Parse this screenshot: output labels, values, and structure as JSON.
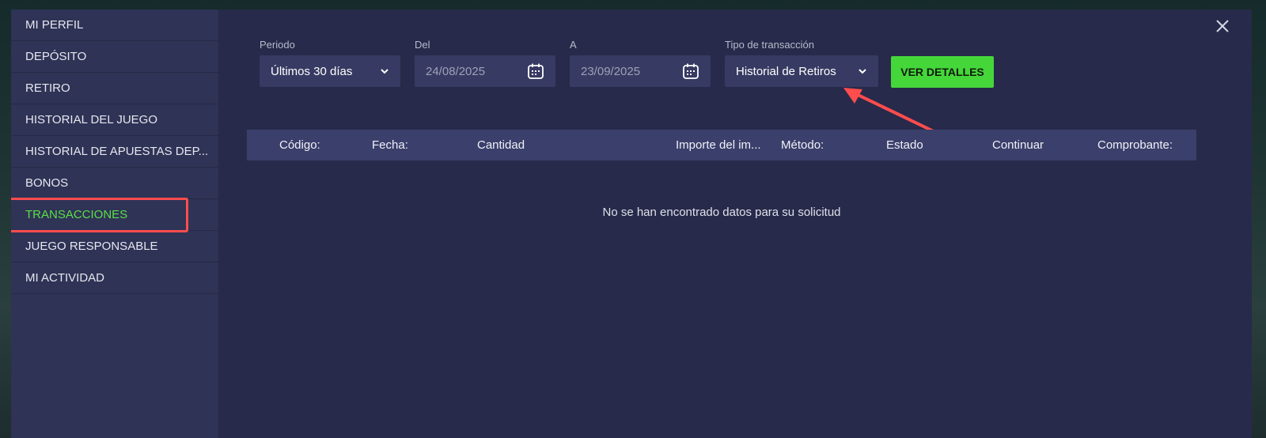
{
  "sidebar": {
    "items": [
      {
        "label": "MI PERFIL"
      },
      {
        "label": "DEPÓSITO"
      },
      {
        "label": "RETIRO"
      },
      {
        "label": "HISTORIAL DEL JUEGO"
      },
      {
        "label": "HISTORIAL DE APUESTAS DEP..."
      },
      {
        "label": "BONOS"
      },
      {
        "label": "TRANSACCIONES",
        "active": true
      },
      {
        "label": "JUEGO RESPONSABLE"
      },
      {
        "label": "MI ACTIVIDAD"
      }
    ]
  },
  "filters": {
    "period": {
      "label": "Periodo",
      "value": "Últimos 30 días"
    },
    "from": {
      "label": "Del",
      "value": "24/08/2025"
    },
    "to": {
      "label": "A",
      "value": "23/09/2025"
    },
    "type": {
      "label": "Tipo de transacción",
      "value": "Historial de Retiros"
    },
    "submit_label": "VER DETALLES"
  },
  "table": {
    "columns": [
      "Código:",
      "Fecha:",
      "Cantidad",
      "Importe del im...",
      "Método:",
      "Estado",
      "Continuar",
      "Comprobante:"
    ],
    "empty_message": "No se han encontrado datos para su solicitud"
  },
  "icons": {
    "close": "close-icon",
    "chevron": "chevron-down-icon",
    "calendar": "calendar-icon"
  },
  "colors": {
    "accent_green": "#45d63a",
    "active_text": "#5ae046",
    "annotation_red": "#ff4d4d"
  }
}
